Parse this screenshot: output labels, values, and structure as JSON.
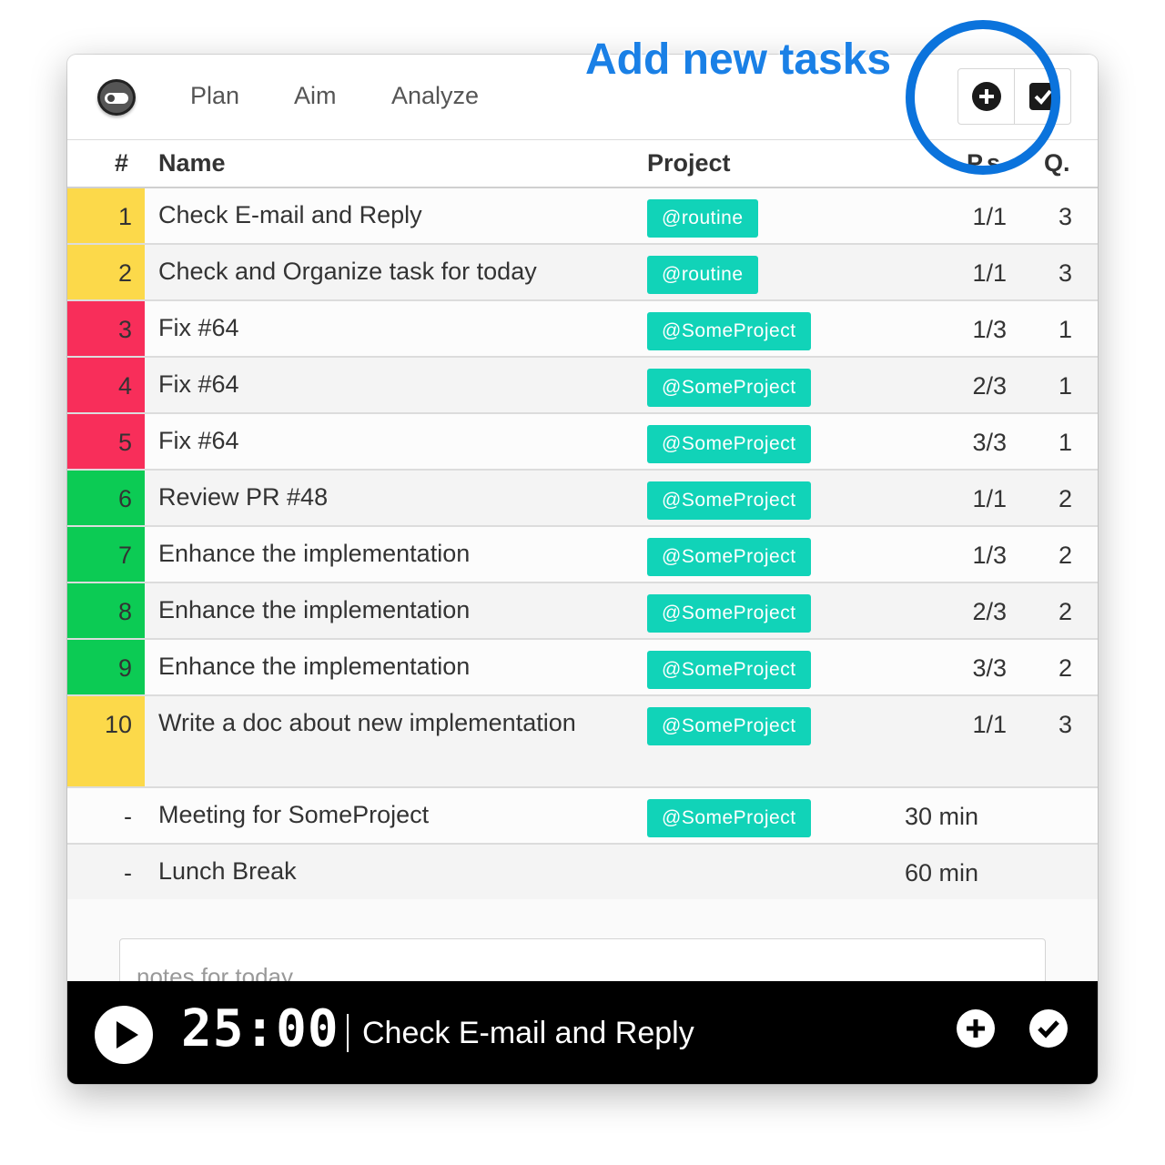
{
  "header": {
    "nav": [
      "Plan",
      "Aim",
      "Analyze"
    ]
  },
  "table": {
    "columns": {
      "num": "#",
      "name": "Name",
      "project": "Project",
      "ps": "P.s",
      "q": "Q."
    },
    "rows": [
      {
        "num": "1",
        "color": "#fcd94a",
        "name": "Check E-mail and Reply",
        "project": "@routine",
        "ps": "1/1",
        "q": "3"
      },
      {
        "num": "2",
        "color": "#fcd94a",
        "name": "Check and Organize task for today",
        "project": "@routine",
        "ps": "1/1",
        "q": "3"
      },
      {
        "num": "3",
        "color": "#f82e5a",
        "name": "Fix #64",
        "project": "@SomeProject",
        "ps": "1/3",
        "q": "1"
      },
      {
        "num": "4",
        "color": "#f82e5a",
        "name": "Fix #64",
        "project": "@SomeProject",
        "ps": "2/3",
        "q": "1"
      },
      {
        "num": "5",
        "color": "#f82e5a",
        "name": "Fix #64",
        "project": "@SomeProject",
        "ps": "3/3",
        "q": "1"
      },
      {
        "num": "6",
        "color": "#0ccb54",
        "name": "Review PR #48",
        "project": "@SomeProject",
        "ps": "1/1",
        "q": "2"
      },
      {
        "num": "7",
        "color": "#0ccb54",
        "name": "Enhance the implementation",
        "project": "@SomeProject",
        "ps": "1/3",
        "q": "2"
      },
      {
        "num": "8",
        "color": "#0ccb54",
        "name": "Enhance the implementation",
        "project": "@SomeProject",
        "ps": "2/3",
        "q": "2"
      },
      {
        "num": "9",
        "color": "#0ccb54",
        "name": "Enhance the implementation",
        "project": "@SomeProject",
        "ps": "3/3",
        "q": "2"
      },
      {
        "num": "10",
        "color": "#fcd94a",
        "name": "Write a doc about new implementation",
        "project": "@SomeProject",
        "ps": "1/1",
        "q": "3"
      }
    ],
    "breaks": [
      {
        "num": "-",
        "name": "Meeting for SomeProject",
        "project": "@SomeProject",
        "duration": "30 min"
      },
      {
        "num": "-",
        "name": "Lunch Break",
        "project": "",
        "duration": "60 min"
      }
    ]
  },
  "notes": {
    "placeholder": "notes for today"
  },
  "timer_bar": {
    "time": "25:00",
    "current_task": "Check E-mail and Reply"
  },
  "annotation": {
    "text": "Add new tasks"
  },
  "colors": {
    "tag": "#11d3b8",
    "quadrant_yellow": "#fcd94a",
    "quadrant_red": "#f82e5a",
    "quadrant_green": "#0ccb54",
    "annotation_blue": "#0b73dc"
  },
  "icons": [
    "app-logo-icon",
    "plus-circle-icon",
    "checkbox-icon",
    "play-icon",
    "check-circle-icon"
  ]
}
